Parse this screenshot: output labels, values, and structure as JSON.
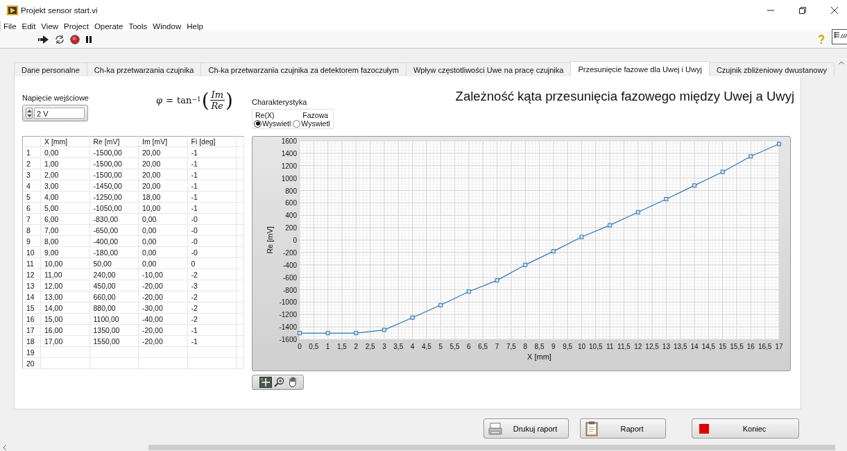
{
  "window": {
    "title": "Projekt sensor start.vi"
  },
  "menu": [
    "File",
    "Edit",
    "View",
    "Project",
    "Operate",
    "Tools",
    "Window",
    "Help"
  ],
  "tabs": [
    {
      "label": "Dane personalne",
      "selected": false
    },
    {
      "label": "Ch-ka przetwarzania czujnika",
      "selected": false
    },
    {
      "label": "Ch-ka przetwarzania czujnika za detektorem fazoczułym",
      "selected": false
    },
    {
      "label": "Wpływ częstotliwości Uwe na pracę czujnika",
      "selected": false
    },
    {
      "label": "Przesunięcie fazowe dla Uwej i Uwyj",
      "selected": true
    },
    {
      "label": "Czujnik zbliżeniowy dwustanowy",
      "selected": false
    }
  ],
  "input_voltage": {
    "label": "Napięcie wejściowe",
    "value": "2 V"
  },
  "formula": {
    "lhs": "φ",
    "eq": "=",
    "func": "tan",
    "exp": "−1",
    "open": "(",
    "num": "Im",
    "den": "Re",
    "close": ")"
  },
  "characteristic": {
    "label": "Charakterystyka",
    "options": [
      {
        "heading": "Re(X)",
        "label": "Wyswietl",
        "selected": true
      },
      {
        "heading": "Fazowa",
        "label": "Wyswietl",
        "selected": false
      }
    ]
  },
  "chart_title": "Zależność kąta przesunięcia fazowego między Uwej a Uwyj",
  "table": {
    "columns": [
      "X [mm]",
      "Re [mV]",
      "Im [mV]",
      "Fi [deg]"
    ],
    "rows": [
      {
        "index": "1",
        "cells": [
          "0,00",
          "-1500,00",
          "20,00",
          "-1"
        ]
      },
      {
        "index": "2",
        "cells": [
          "1,00",
          "-1500,00",
          "20,00",
          "-1"
        ]
      },
      {
        "index": "3",
        "cells": [
          "2,00",
          "-1500,00",
          "20,00",
          "-1"
        ]
      },
      {
        "index": "4",
        "cells": [
          "3,00",
          "-1450,00",
          "20,00",
          "-1"
        ]
      },
      {
        "index": "5",
        "cells": [
          "4,00",
          "-1250,00",
          "18,00",
          "-1"
        ]
      },
      {
        "index": "6",
        "cells": [
          "5,00",
          "-1050,00",
          "10,00",
          "-1"
        ]
      },
      {
        "index": "7",
        "cells": [
          "6,00",
          "-830,00",
          "0,00",
          "-0"
        ]
      },
      {
        "index": "8",
        "cells": [
          "7,00",
          "-650,00",
          "0,00",
          "-0"
        ]
      },
      {
        "index": "9",
        "cells": [
          "8,00",
          "-400,00",
          "0,00",
          "-0"
        ]
      },
      {
        "index": "10",
        "cells": [
          "9,00",
          "-180,00",
          "0,00",
          "-0"
        ]
      },
      {
        "index": "11",
        "cells": [
          "10,00",
          "50,00",
          "0,00",
          "0"
        ]
      },
      {
        "index": "12",
        "cells": [
          "11,00",
          "240,00",
          "-10,00",
          "-2"
        ]
      },
      {
        "index": "13",
        "cells": [
          "12,00",
          "450,00",
          "-20,00",
          "-3"
        ]
      },
      {
        "index": "14",
        "cells": [
          "13,00",
          "660,00",
          "-20,00",
          "-2"
        ]
      },
      {
        "index": "15",
        "cells": [
          "14,00",
          "880,00",
          "-30,00",
          "-2"
        ]
      },
      {
        "index": "16",
        "cells": [
          "15,00",
          "1100,00",
          "-40,00",
          "-2"
        ]
      },
      {
        "index": "17",
        "cells": [
          "16,00",
          "1350,00",
          "-20,00",
          "-1"
        ]
      },
      {
        "index": "18",
        "cells": [
          "17,00",
          "1550,00",
          "-20,00",
          "-1"
        ]
      },
      {
        "index": "19",
        "cells": []
      },
      {
        "index": "20",
        "cells": []
      }
    ]
  },
  "chart": {
    "chart_data": {
      "type": "line",
      "xlabel": "X [mm]",
      "ylabel": "Re [mV]",
      "x": [
        0,
        1,
        2,
        3,
        4,
        5,
        6,
        7,
        8,
        9,
        10,
        11,
        12,
        13,
        14,
        15,
        16,
        17
      ],
      "grid": true,
      "series": [
        {
          "color": "#2e75b6",
          "marker": "square",
          "values": [
            -1500,
            -1500,
            -1500,
            -1450,
            -1250,
            -1050,
            -830,
            -650,
            -400,
            -180,
            50,
            240,
            450,
            660,
            880,
            1100,
            1350,
            1550
          ]
        }
      ],
      "xlim": [
        0,
        17
      ],
      "ylim": [
        -1600,
        1600
      ],
      "xticks": [
        0,
        {
          "value": 0.5,
          "label": "0,5"
        },
        1,
        {
          "value": 1.5,
          "label": "1,5"
        },
        2,
        {
          "value": 2.5,
          "label": "2,5"
        },
        3,
        {
          "value": 3.5,
          "label": "3,5"
        },
        4,
        {
          "value": 4.5,
          "label": "4,5"
        },
        5,
        {
          "value": 5.5,
          "label": "5,5"
        },
        6,
        {
          "value": 6.5,
          "label": "6,5"
        },
        7,
        {
          "value": 7.5,
          "label": "7,5"
        },
        8,
        {
          "value": 8.5,
          "label": "8,5"
        },
        9,
        {
          "value": 9.5,
          "label": "9,5"
        },
        10,
        {
          "value": 10.5,
          "label": "10,5"
        },
        11,
        {
          "value": 11.5,
          "label": "11,5"
        },
        12,
        {
          "value": 12.5,
          "label": "12,5"
        },
        13,
        {
          "value": 13.5,
          "label": "13,5"
        },
        14,
        {
          "value": 14.5,
          "label": "14,5"
        },
        15,
        {
          "value": 15.5,
          "label": "15,5"
        },
        16,
        {
          "value": 16.5,
          "label": "16,5"
        },
        17
      ],
      "yticks": [
        -1600,
        -1400,
        -1200,
        -1000,
        -800,
        -600,
        -400,
        -200,
        0,
        200,
        400,
        600,
        800,
        1000,
        1200,
        1400,
        1600
      ]
    }
  },
  "buttons": [
    {
      "kind": "print",
      "label": "Drukuj raport"
    },
    {
      "kind": "report",
      "label": "Raport"
    },
    {
      "kind": "stop",
      "label": "Koniec"
    }
  ]
}
